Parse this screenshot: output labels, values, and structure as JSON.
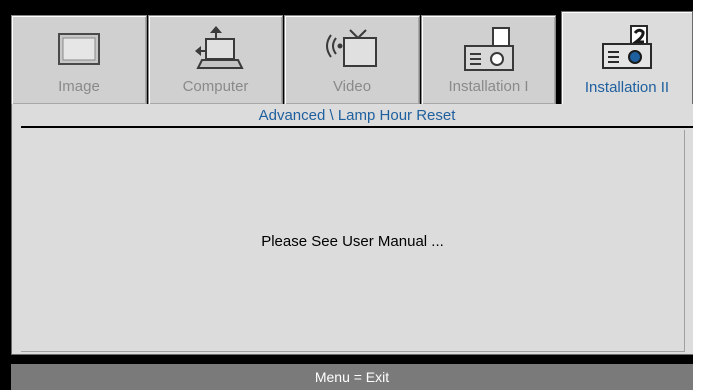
{
  "tabs": [
    {
      "label": "Image",
      "icon": "image-icon",
      "active": false
    },
    {
      "label": "Computer",
      "icon": "computer-icon",
      "active": false
    },
    {
      "label": "Video",
      "icon": "video-icon",
      "active": false
    },
    {
      "label": "Installation I",
      "icon": "installation-1-icon",
      "active": false
    },
    {
      "label": "Installation II",
      "icon": "installation-2-icon",
      "active": true
    }
  ],
  "breadcrumb": "Advanced \\ Lamp Hour Reset",
  "message": "Please See User Manual ...",
  "footer": "Menu = Exit",
  "colors": {
    "accent": "#1e5f9e",
    "panel": "#dcdcdc",
    "tab_inactive": "#d0d0d0",
    "frame": "#000000",
    "footer_bar": "#7a7a7a"
  }
}
